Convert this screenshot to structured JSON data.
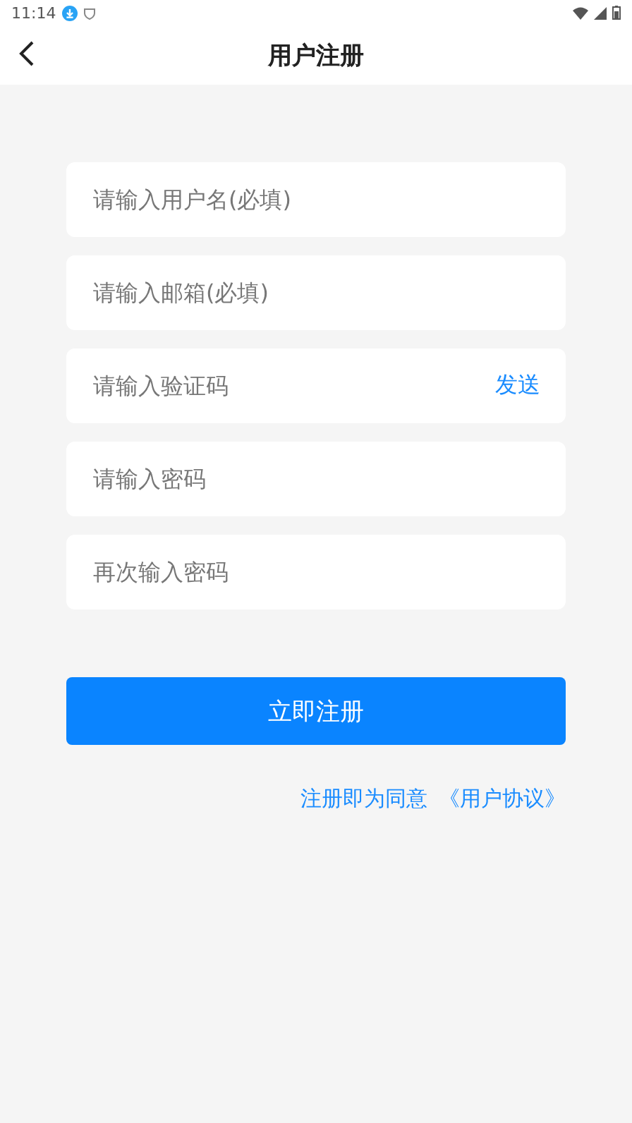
{
  "status_bar": {
    "time": "11:14"
  },
  "header": {
    "title": "用户注册"
  },
  "fields": [
    {
      "placeholder": "请输入用户名(必填)"
    },
    {
      "placeholder": "请输入邮箱(必填)"
    },
    {
      "placeholder": "请输入验证码",
      "action": "发送"
    },
    {
      "placeholder": "请输入密码"
    },
    {
      "placeholder": "再次输入密码"
    }
  ],
  "submit": "立即注册",
  "agreement": {
    "text": "注册即为同意",
    "link": "《用户协议》"
  }
}
